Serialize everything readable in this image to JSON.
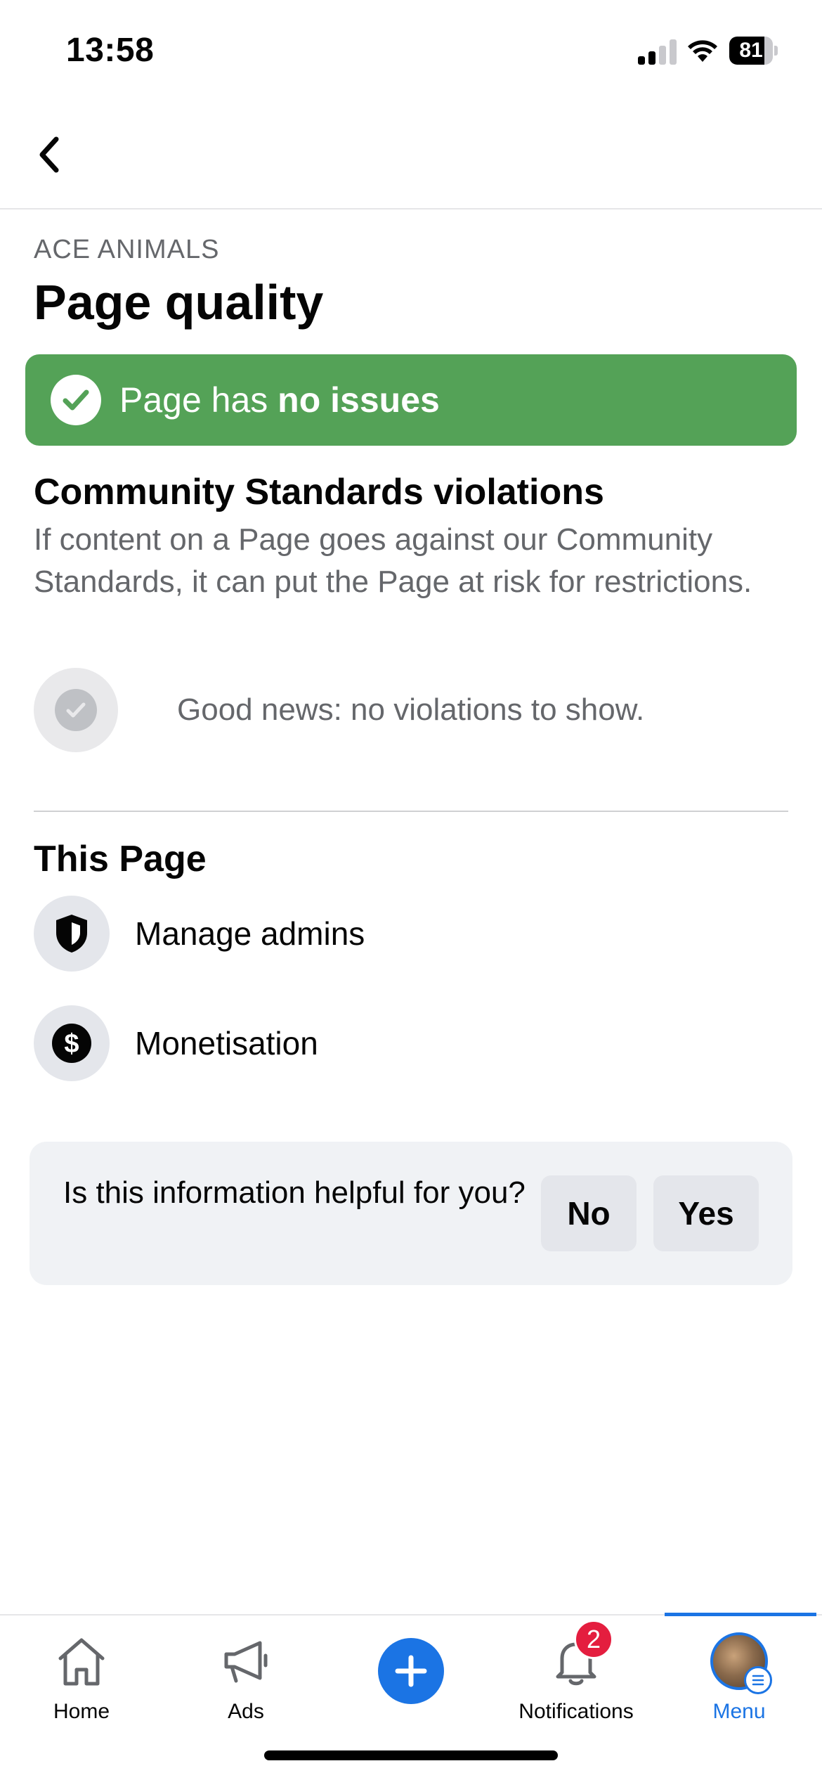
{
  "status_bar": {
    "time": "13:58",
    "battery": "81",
    "battery_level": 0.81
  },
  "header": {
    "back_icon": "chevron-left-icon"
  },
  "page": {
    "name": "ACE ANIMALS",
    "title": "Page quality"
  },
  "banner": {
    "prefix": "Page has ",
    "emphasis": "no issues",
    "color": "#54a257",
    "icon": "check-icon"
  },
  "community": {
    "heading": "Community Standards violations",
    "description": "If content on a Page goes against our Community Standards, it can put the Page at risk for restrictions.",
    "empty_state": "Good news: no violations to show."
  },
  "this_page": {
    "heading": "This Page",
    "items": [
      {
        "label": "Manage admins",
        "icon": "shield-icon"
      },
      {
        "label": "Monetisation",
        "icon": "dollar-icon"
      }
    ]
  },
  "feedback": {
    "question": "Is this information helpful for you?",
    "no_label": "No",
    "yes_label": "Yes"
  },
  "tab_bar": {
    "accent": "#1b74e4",
    "tabs": [
      {
        "label": "Home",
        "icon": "home-icon"
      },
      {
        "label": "Ads",
        "icon": "megaphone-icon"
      },
      {
        "label": "",
        "icon": "plus-icon"
      },
      {
        "label": "Notifications",
        "icon": "bell-icon",
        "badge": "2"
      },
      {
        "label": "Menu",
        "icon": "avatar",
        "active": true
      }
    ]
  }
}
